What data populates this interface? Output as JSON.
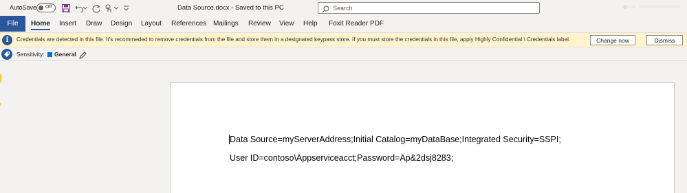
{
  "titlebar": {
    "autosave_label": "AutoSave",
    "autosave_state": "Off",
    "document_title": "Data Source.docx  -  Saved to this PC",
    "search_placeholder": "Search"
  },
  "ribbon": {
    "file_tab": "File",
    "tabs": [
      "Home",
      "Insert",
      "Draw",
      "Design",
      "Layout",
      "References",
      "Mailings",
      "Review",
      "View",
      "Help",
      "Foxit Reader PDF"
    ],
    "active_tab": "Home",
    "accent_color": "#2b579a"
  },
  "infobar": {
    "message": "Credentials are detected in this file. It's recommeded to remove credentials from the file and store them in a designated keypass store. If you must store the credentials in this file, apply Highly Confidential \\ Credentials label.",
    "change_button": "Change now",
    "dismiss_button": "Dismiss",
    "background_color": "#fff4ce"
  },
  "sensitivity": {
    "label": "Sensitivity:",
    "value": "General"
  },
  "document": {
    "lines": [
      "Data Source=myServerAddress;Initial Catalog=myDataBase;Integrated Security=SSPI;",
      "User ID=contoso\\Appserviceacct;Password=Ap&2dsj8283;"
    ]
  },
  "icons": {
    "save": "save-icon",
    "undo": "undo-icon",
    "redo": "redo-icon",
    "touch_mode": "touch-mode-icon",
    "customize": "customize-quick-access-icon",
    "search": "search-icon",
    "info": "info-icon",
    "sensitivity": "sensitivity-icon",
    "edit": "pencil-icon"
  }
}
